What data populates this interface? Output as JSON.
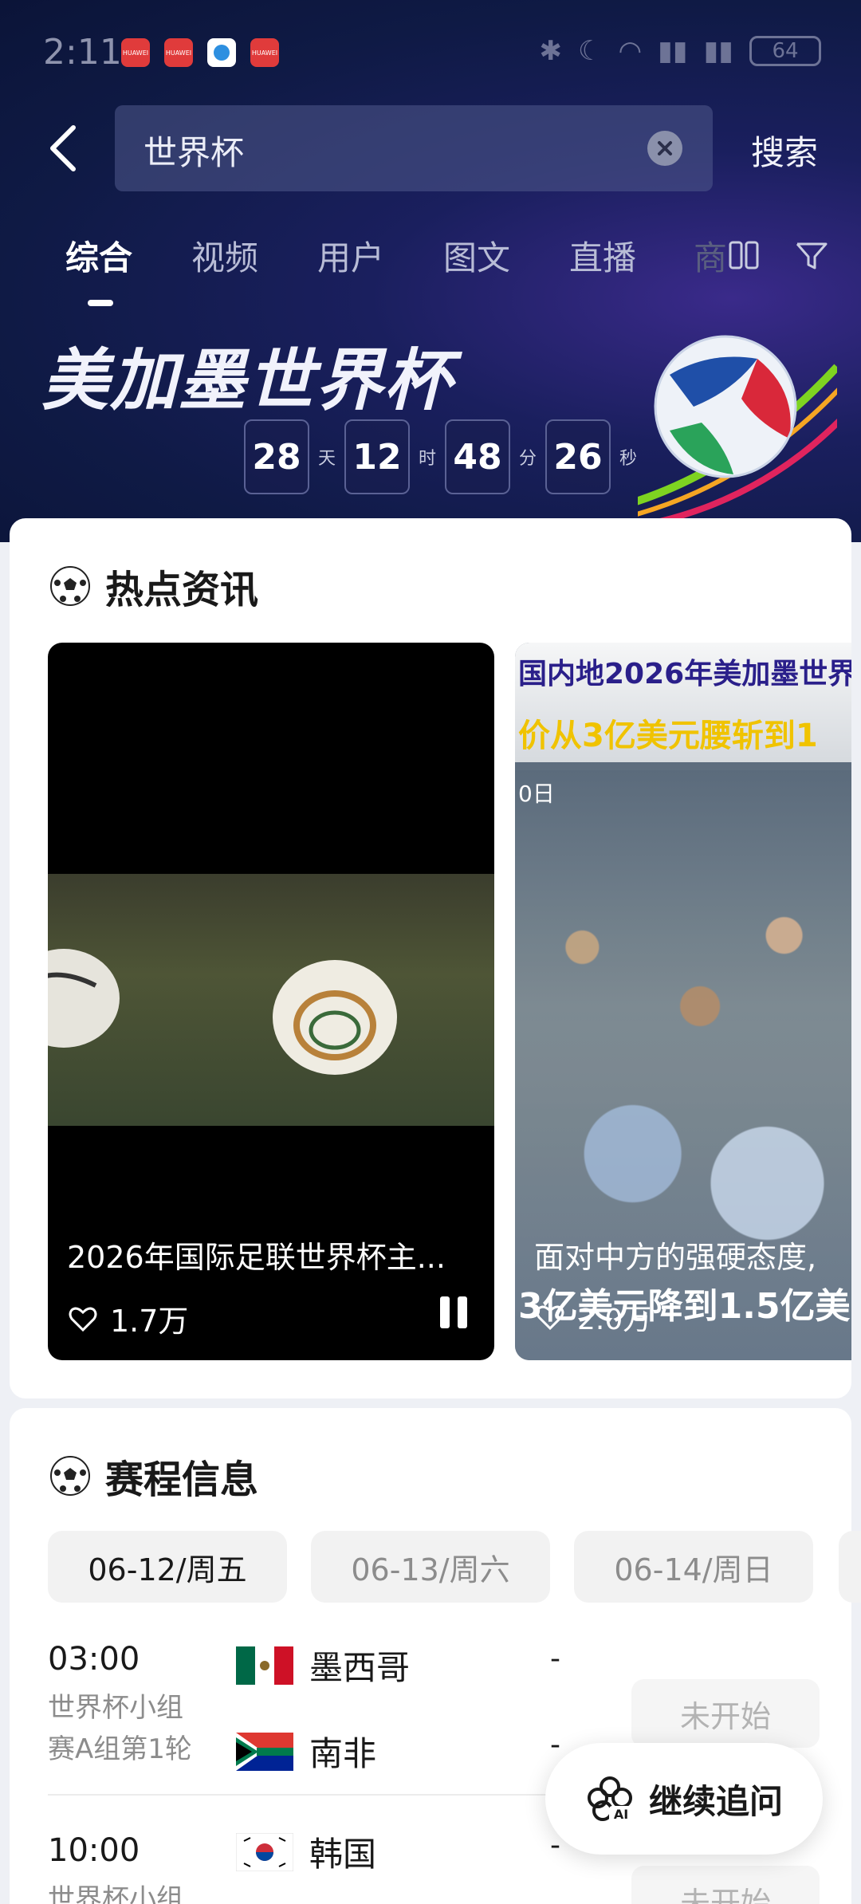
{
  "status_bar": {
    "time": "2:11",
    "battery": "64",
    "app_icons": [
      "huawei-store-icon",
      "huawei-store-icon",
      "browser-icon",
      "huawei-store-icon"
    ],
    "app_icon_label": "HUAWEI"
  },
  "search": {
    "query": "世界杯",
    "submit_label": "搜索"
  },
  "tabs": [
    {
      "label": "综合",
      "active": true
    },
    {
      "label": "视频",
      "active": false
    },
    {
      "label": "用户",
      "active": false
    },
    {
      "label": "图文",
      "active": false
    },
    {
      "label": "直播",
      "active": false
    }
  ],
  "tab_overflow_label": "商",
  "hero": {
    "title": "美加墨世界杯",
    "countdown": {
      "days": "28",
      "days_unit": "天",
      "hours": "12",
      "hours_unit": "时",
      "minutes": "48",
      "minutes_unit": "分",
      "seconds": "26",
      "seconds_unit": "秒"
    }
  },
  "news": {
    "section_title": "热点资讯",
    "videos": [
      {
        "title": "2026年国际足联世界杯主...",
        "likes": "1.7万"
      },
      {
        "overlay_line1": "国内地2026年美加墨世界",
        "overlay_line2": "价从3亿美元腰斩到1",
        "overlay_date": "0日",
        "caption_line1": "面对中方的强硬态度,",
        "caption_line2": "3亿美元降到1.5亿美",
        "likes": "2.0万"
      }
    ]
  },
  "schedule": {
    "section_title": "赛程信息",
    "dates": [
      {
        "label": "06-12/周五",
        "active": true
      },
      {
        "label": "06-13/周六",
        "active": false
      },
      {
        "label": "06-14/周日",
        "active": false
      }
    ],
    "matches": [
      {
        "time": "03:00",
        "league_line1": "世界杯小组",
        "league_line2": "赛A组第1轮",
        "home": {
          "name": "墨西哥",
          "score": "-"
        },
        "away": {
          "name": "南非",
          "score": "-"
        },
        "status": "未开始"
      },
      {
        "time": "10:00",
        "league_line1": "世界杯小组",
        "home": {
          "name": "韩国",
          "score": "-"
        },
        "status": "未开始"
      }
    ]
  },
  "fab": {
    "label": "继续追问"
  },
  "colors": {
    "hero_bg": "#0f1a45",
    "card_bg": "#ffffff",
    "page_bg": "#eef0f5",
    "inactive_tab": "#b8bcd6"
  }
}
